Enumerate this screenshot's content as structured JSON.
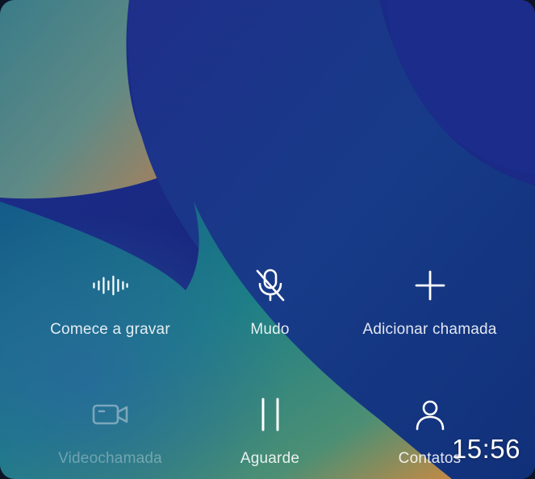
{
  "controls": {
    "record": {
      "label": "Comece a gravar",
      "icon": "waveform-icon",
      "enabled": true
    },
    "mute": {
      "label": "Mudo",
      "icon": "mic-off-icon",
      "enabled": true
    },
    "add_call": {
      "label": "Adicionar chamada",
      "icon": "plus-icon",
      "enabled": true
    },
    "video_call": {
      "label": "Videochamada",
      "icon": "video-camera-icon",
      "enabled": false
    },
    "hold": {
      "label": "Aguarde",
      "icon": "pause-icon",
      "enabled": true
    },
    "contacts": {
      "label": "Contatos",
      "icon": "person-icon",
      "enabled": true
    }
  },
  "status": {
    "time": "15:56"
  },
  "colors": {
    "wallpaper_deep_blue": "#1a2c8c",
    "wallpaper_teal": "#1f7f80",
    "wallpaper_orange": "#c68a4a",
    "icon_color": "#ffffff"
  }
}
